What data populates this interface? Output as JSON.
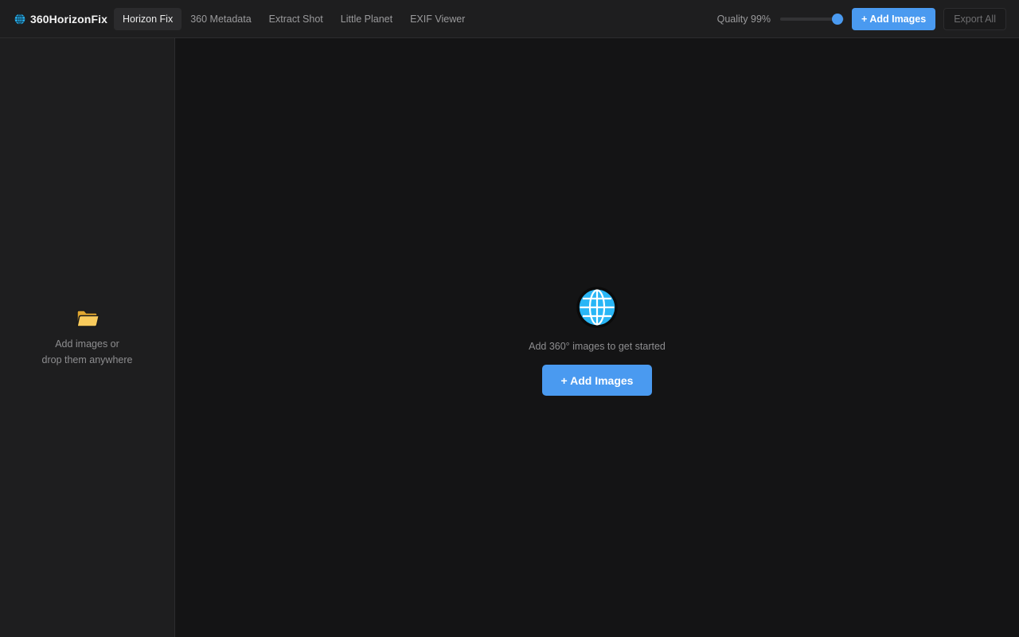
{
  "app": {
    "name": "360HorizonFix",
    "logo_icon": "globe-icon"
  },
  "tabs": [
    {
      "label": "Horizon Fix",
      "active": true
    },
    {
      "label": "360 Metadata",
      "active": false
    },
    {
      "label": "Extract Shot",
      "active": false
    },
    {
      "label": "Little Planet",
      "active": false
    },
    {
      "label": "EXIF Viewer",
      "active": false
    }
  ],
  "toolbar": {
    "quality_label": "Quality 99%",
    "quality_value": 99,
    "add_images_label": "+ Add Images",
    "export_all_label": "Export All"
  },
  "sidebar": {
    "icon": "folder-icon",
    "hint_line1": "Add images or",
    "hint_line2": "drop them anywhere"
  },
  "main": {
    "icon": "globe-icon",
    "empty_text": "Add 360° images to get started",
    "add_images_label": "+ Add Images"
  },
  "colors": {
    "accent": "#4a9af0",
    "background": "#141415",
    "panel": "#1e1e1f",
    "globe": "#29b6f6",
    "folder": "#f5c04a"
  }
}
